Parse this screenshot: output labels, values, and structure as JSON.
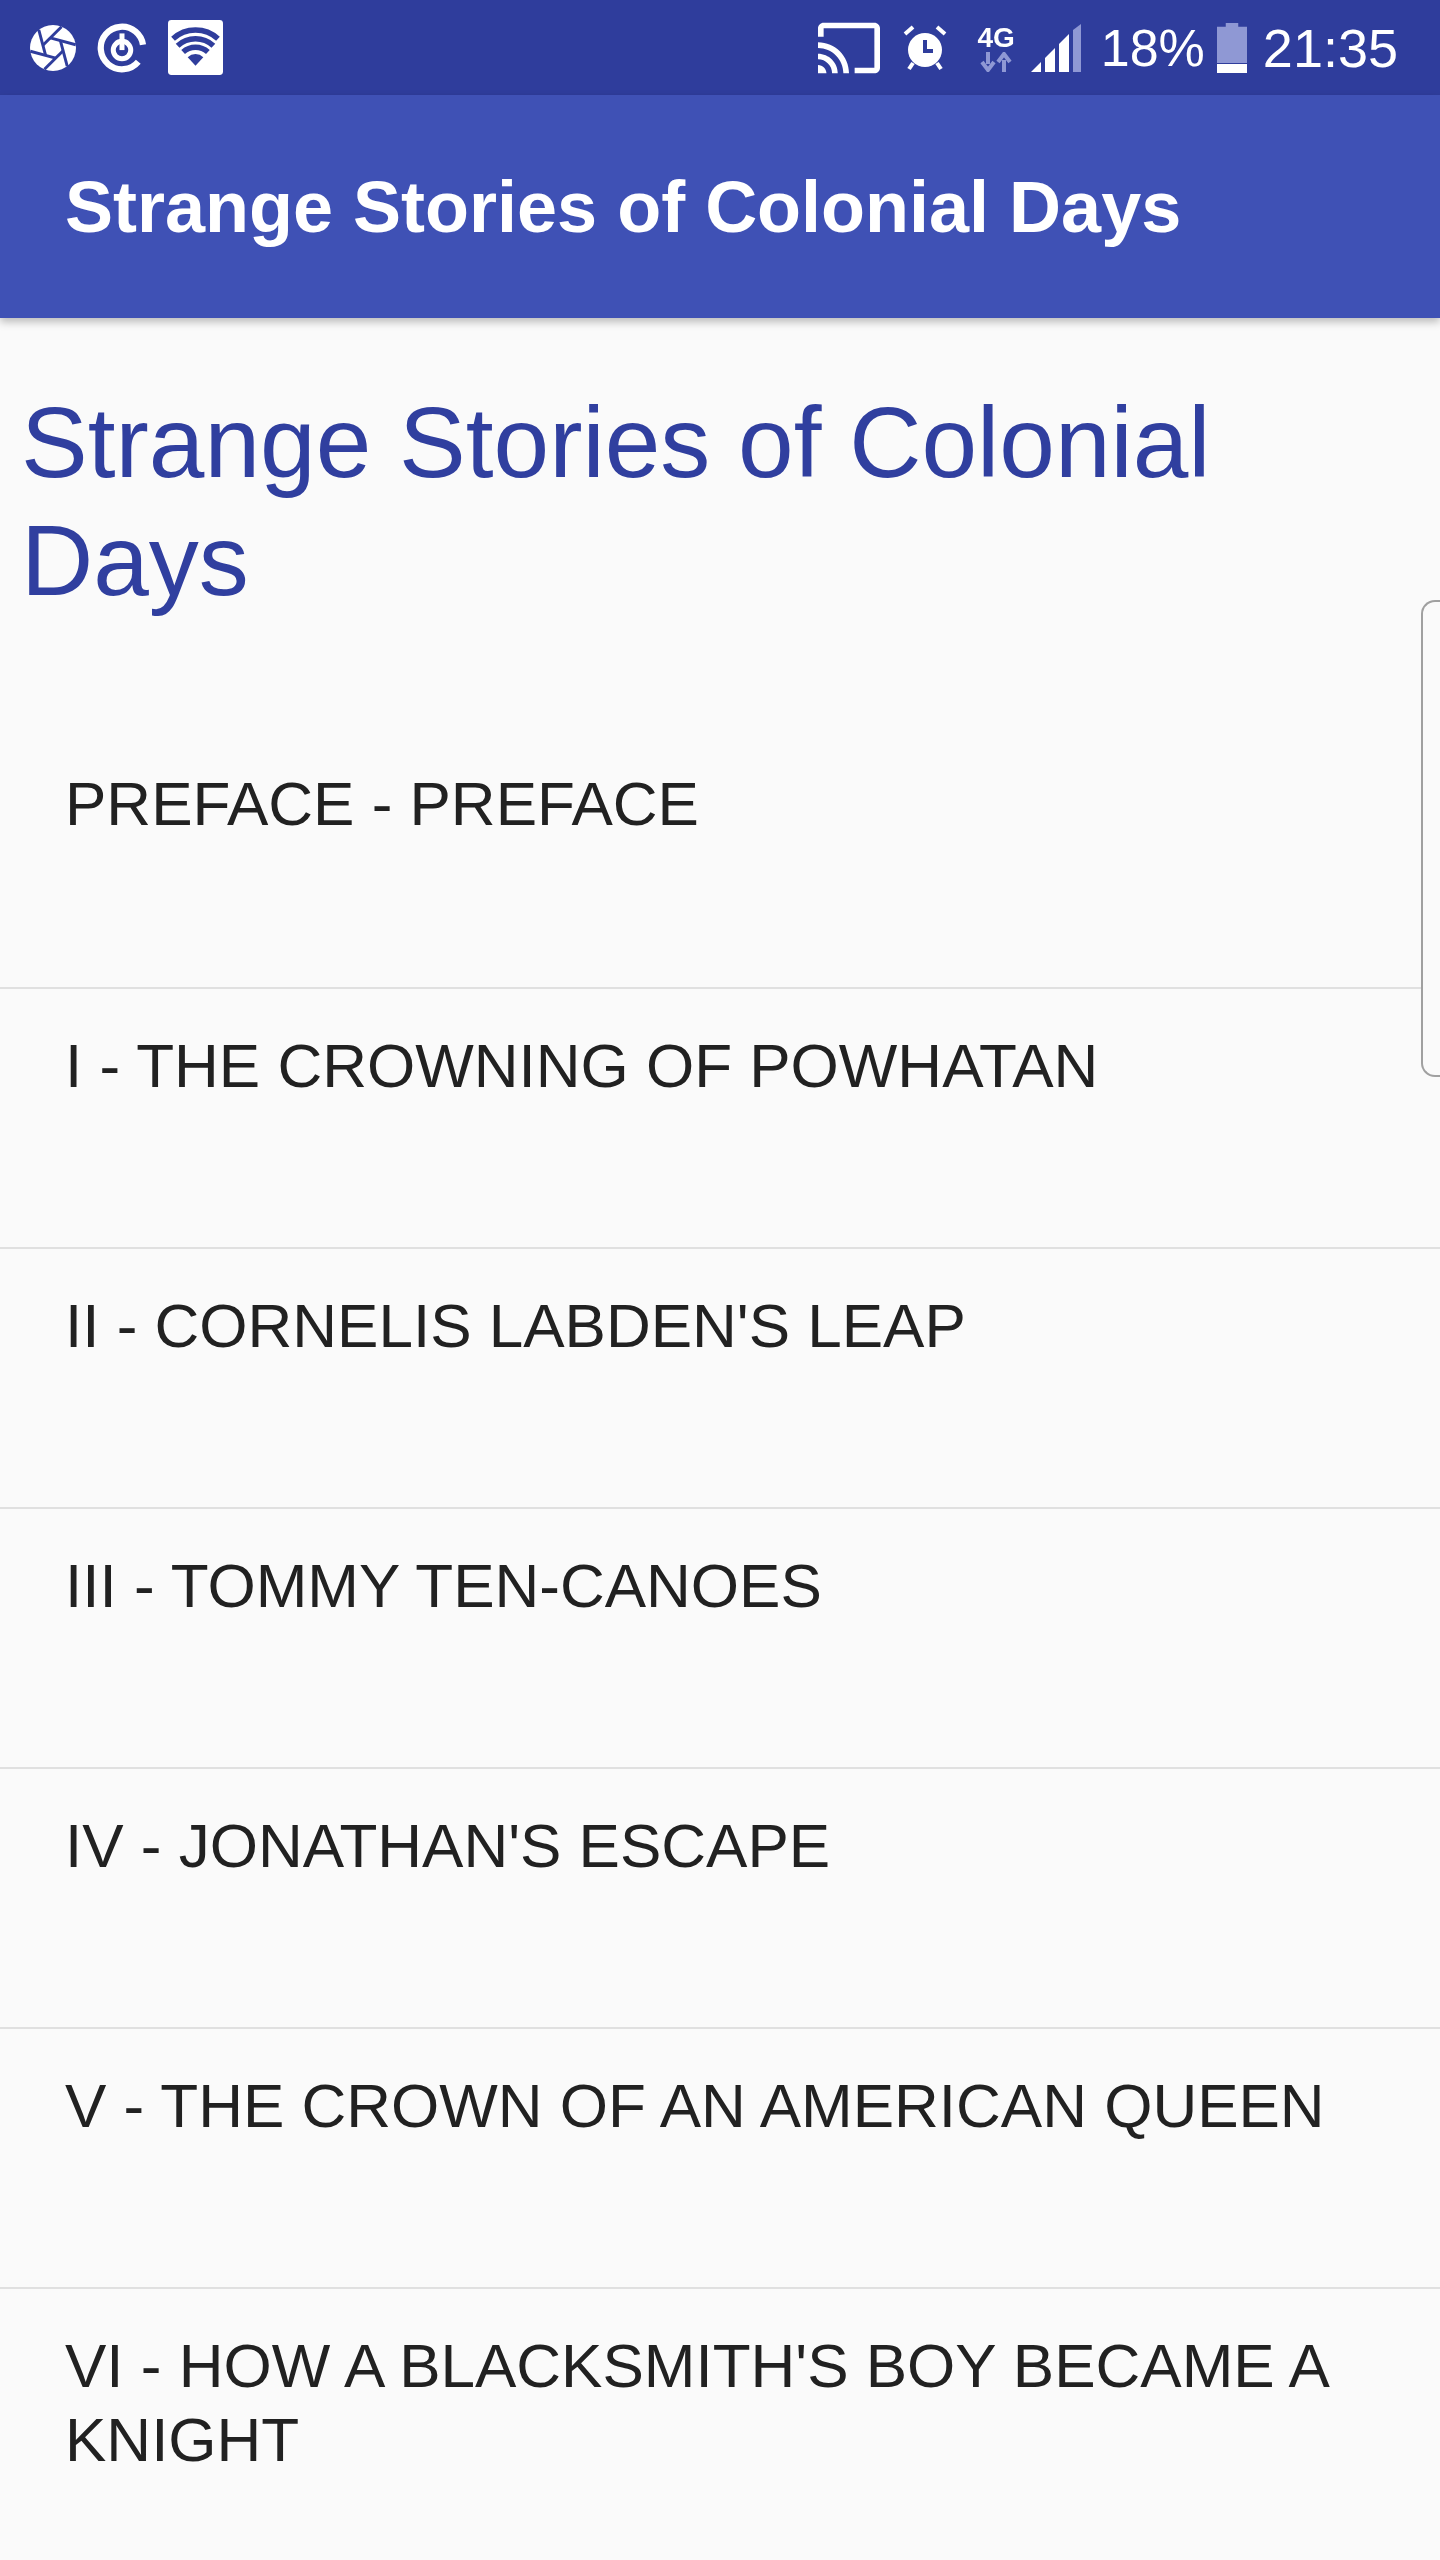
{
  "status_bar": {
    "network_type": "4G",
    "battery": "18%",
    "time": "21:35"
  },
  "app_bar": {
    "title": "Strange Stories of Colonial Days"
  },
  "book": {
    "title": "Strange Stories of Colonial Days"
  },
  "chapters": [
    "PREFACE - PREFACE",
    "I - THE CROWNING OF POWHATAN",
    "II - CORNELIS LABDEN'S LEAP",
    "III - TOMMY TEN-CANOES",
    "IV - JONATHAN'S ESCAPE",
    "V - THE CROWN OF AN AMERICAN QUEEN",
    "VI - HOW A BLACKSMITH'S BOY BECAME A KNIGHT"
  ]
}
